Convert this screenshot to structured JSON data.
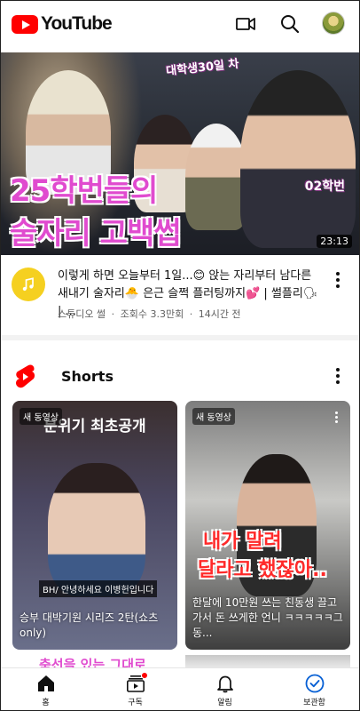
{
  "app": {
    "name": "YouTube"
  },
  "header": {
    "logo_text": "YouTube",
    "icons": [
      "cast-icon",
      "search-icon",
      "account-avatar"
    ]
  },
  "featured_video": {
    "thumbnail": {
      "tag": "대학생30일 차",
      "title_line1": "25학번들의",
      "title_line2": "술자리 고백썹",
      "label": "02학번"
    },
    "duration": "23:13",
    "title": "이렇게 하면 오늘부터 1일...😊 앉는 자리부터 남다른 새내기 술자리🐣 은근 슬쩍 플러팅까지💕 | 썰플리🗣 | ...",
    "channel": "스튜디오 썰",
    "views": "조회수 3.3만회",
    "age": "14시간 전",
    "separator": "·"
  },
  "shorts": {
    "section_title": "Shorts",
    "items": [
      {
        "badge": "새 동영상",
        "overlay_top": "분위기 최초공개",
        "overlay_chip": "BH/ 안녕하세요 이병헌입니다",
        "caption": "승부 대박기원 시리즈 2탄(쇼츠only)"
      },
      {
        "badge": "새 동영상",
        "overlay_line1": "내가 말려",
        "overlay_line2": "달라고 했잖아..",
        "caption": "한달에 10만원 쓰는 친동생 끌고 가서 돈 쓰게한 언니 ㅋㅋㅋㅋㅋ그동..."
      }
    ],
    "next_row_peek": "축선을 있는 그대로"
  },
  "bottom_nav": {
    "items": [
      {
        "label": "홈",
        "icon": "home-icon",
        "active": true
      },
      {
        "label": "구독",
        "icon": "subscriptions-icon",
        "notification": true
      },
      {
        "label": "알림",
        "icon": "bell-icon"
      },
      {
        "label": "보관함",
        "icon": "library-icon"
      }
    ]
  },
  "colors": {
    "brand_red": "#ff0000",
    "thumbnail_pink": "#e04bcf",
    "library_blue": "#065fd4"
  }
}
